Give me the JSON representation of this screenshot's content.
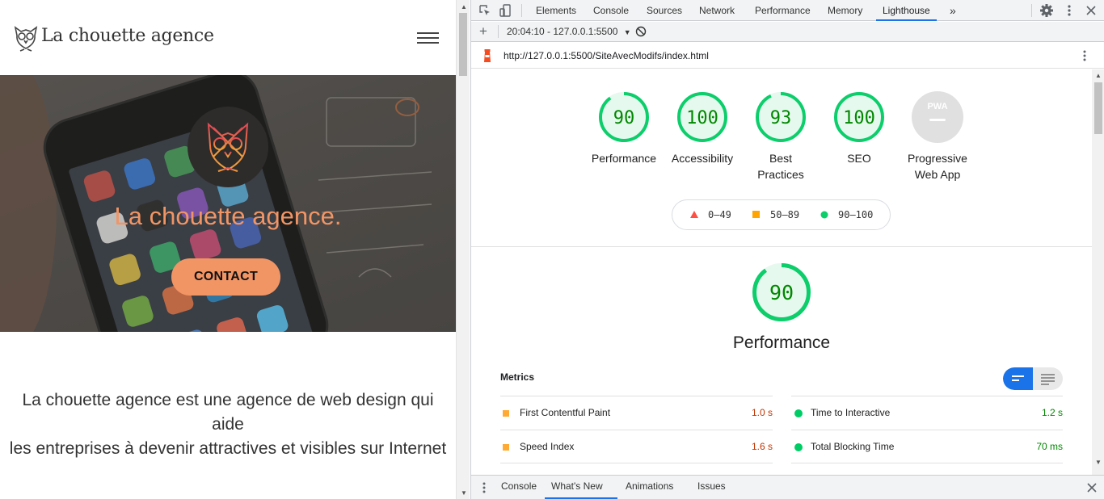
{
  "site": {
    "brand": "La chouette agence",
    "hero_title": "La chouette agence.",
    "contact_label": "CONTACT",
    "intro_text": "La chouette agence est une agence de web design qui aide\nles entreprises à devenir attractives et visibles sur Internet",
    "accent_color": "#f29565",
    "icons": [
      "owl-logo-icon",
      "hamburger-menu-icon"
    ]
  },
  "devtools": {
    "tabs": [
      "Elements",
      "Console",
      "Sources",
      "Network",
      "Performance",
      "Memory",
      "Lighthouse"
    ],
    "active_tab": "Lighthouse",
    "report_select": "20:04:10 - 127.0.0.1:5500",
    "url": "http://127.0.0.1:5500/SiteAvecModifs/index.html",
    "categories": [
      {
        "name": "Performance",
        "score": "90",
        "value": 90
      },
      {
        "name": "Accessibility",
        "score": "100",
        "value": 100
      },
      {
        "name": "Best Practices",
        "line1": "Best",
        "line2": "Practices",
        "score": "93",
        "value": 93
      },
      {
        "name": "SEO",
        "score": "100",
        "value": 100
      },
      {
        "name": "Progressive Web App",
        "line1": "Progressive",
        "line2": "Web App",
        "score": "PWA",
        "value": null
      }
    ],
    "legend": {
      "fail": "0–49",
      "average": "50–89",
      "pass": "90–100"
    },
    "perf_score": "90",
    "perf_value": 90,
    "perf_title": "Performance",
    "metrics_title": "Metrics",
    "metrics": [
      {
        "name": "First Contentful Paint",
        "value": "1.0 s",
        "status": "average"
      },
      {
        "name": "Time to Interactive",
        "value": "1.2 s",
        "status": "pass"
      },
      {
        "name": "Speed Index",
        "value": "1.6 s",
        "status": "average"
      },
      {
        "name": "Total Blocking Time",
        "value": "70 ms",
        "status": "pass"
      }
    ],
    "drawer_tabs": [
      "Console",
      "What's New",
      "Animations",
      "Issues"
    ],
    "active_drawer_tab": "What's New",
    "colors": {
      "pass": "#0cce6b",
      "average": "#ffa400",
      "fail": "#ff4e42",
      "accent": "#1a73e8",
      "pass_text": "#008800",
      "average_text": "#c33300"
    }
  }
}
